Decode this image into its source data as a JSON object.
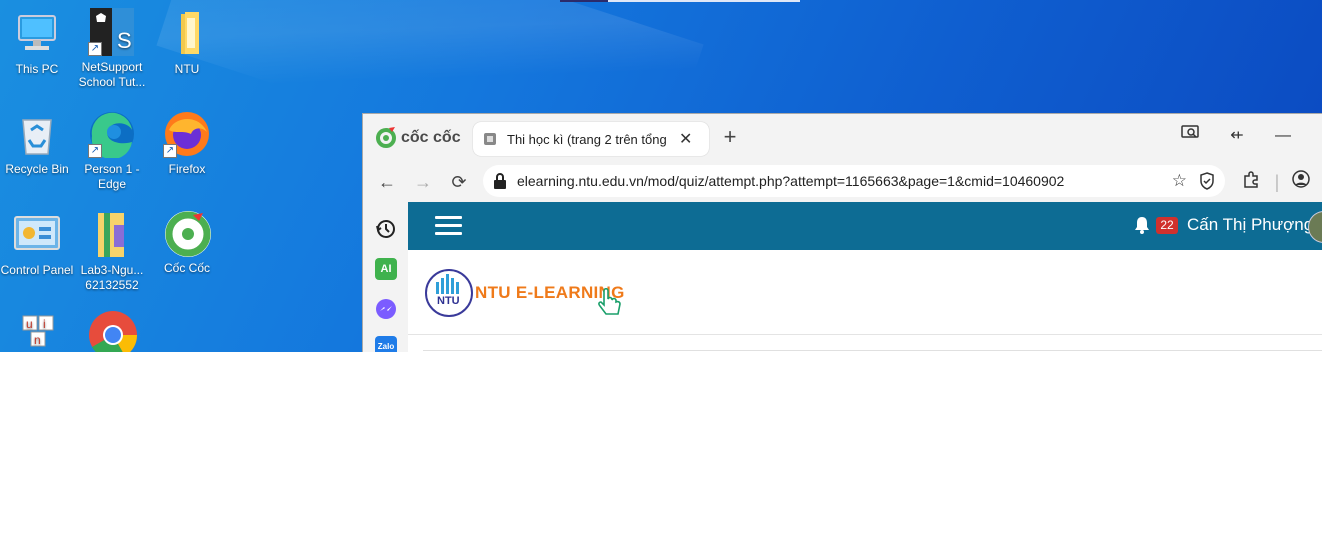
{
  "desktop": {
    "icons": [
      {
        "name": "this-pc",
        "label": "This PC"
      },
      {
        "name": "netsupport",
        "label": "NetSupport School Tut..."
      },
      {
        "name": "ntu-folder",
        "label": "NTU"
      },
      {
        "name": "recycle-bin",
        "label": "Recycle Bin"
      },
      {
        "name": "edge",
        "label": "Person 1 - Edge"
      },
      {
        "name": "firefox",
        "label": "Firefox"
      },
      {
        "name": "control-panel",
        "label": "Control Panel"
      },
      {
        "name": "lab3-file",
        "label": "Lab3-Ngu... 62132552"
      },
      {
        "name": "coccoc",
        "label": "Cốc Cốc"
      }
    ]
  },
  "browser": {
    "brand": "cốc cốc",
    "tab": {
      "title": "Thi học kì (trang 2 trên tổng"
    },
    "url": "elearning.ntu.edu.vn/mod/quiz/attempt.php?attempt=1165663&page=1&cmid=10460902",
    "sidebar_ai_label": "AI",
    "sidebar_zalo_label": "Zalo"
  },
  "site": {
    "notification_count": "22",
    "user_name": "Cấn Thị Phượng",
    "logo_text": "NTU E-LEARNING",
    "logo_badge": "NTU"
  },
  "colors": {
    "navbar": "#0d6c94",
    "logo_text": "#ef7a1a",
    "badge": "#d0312d"
  }
}
